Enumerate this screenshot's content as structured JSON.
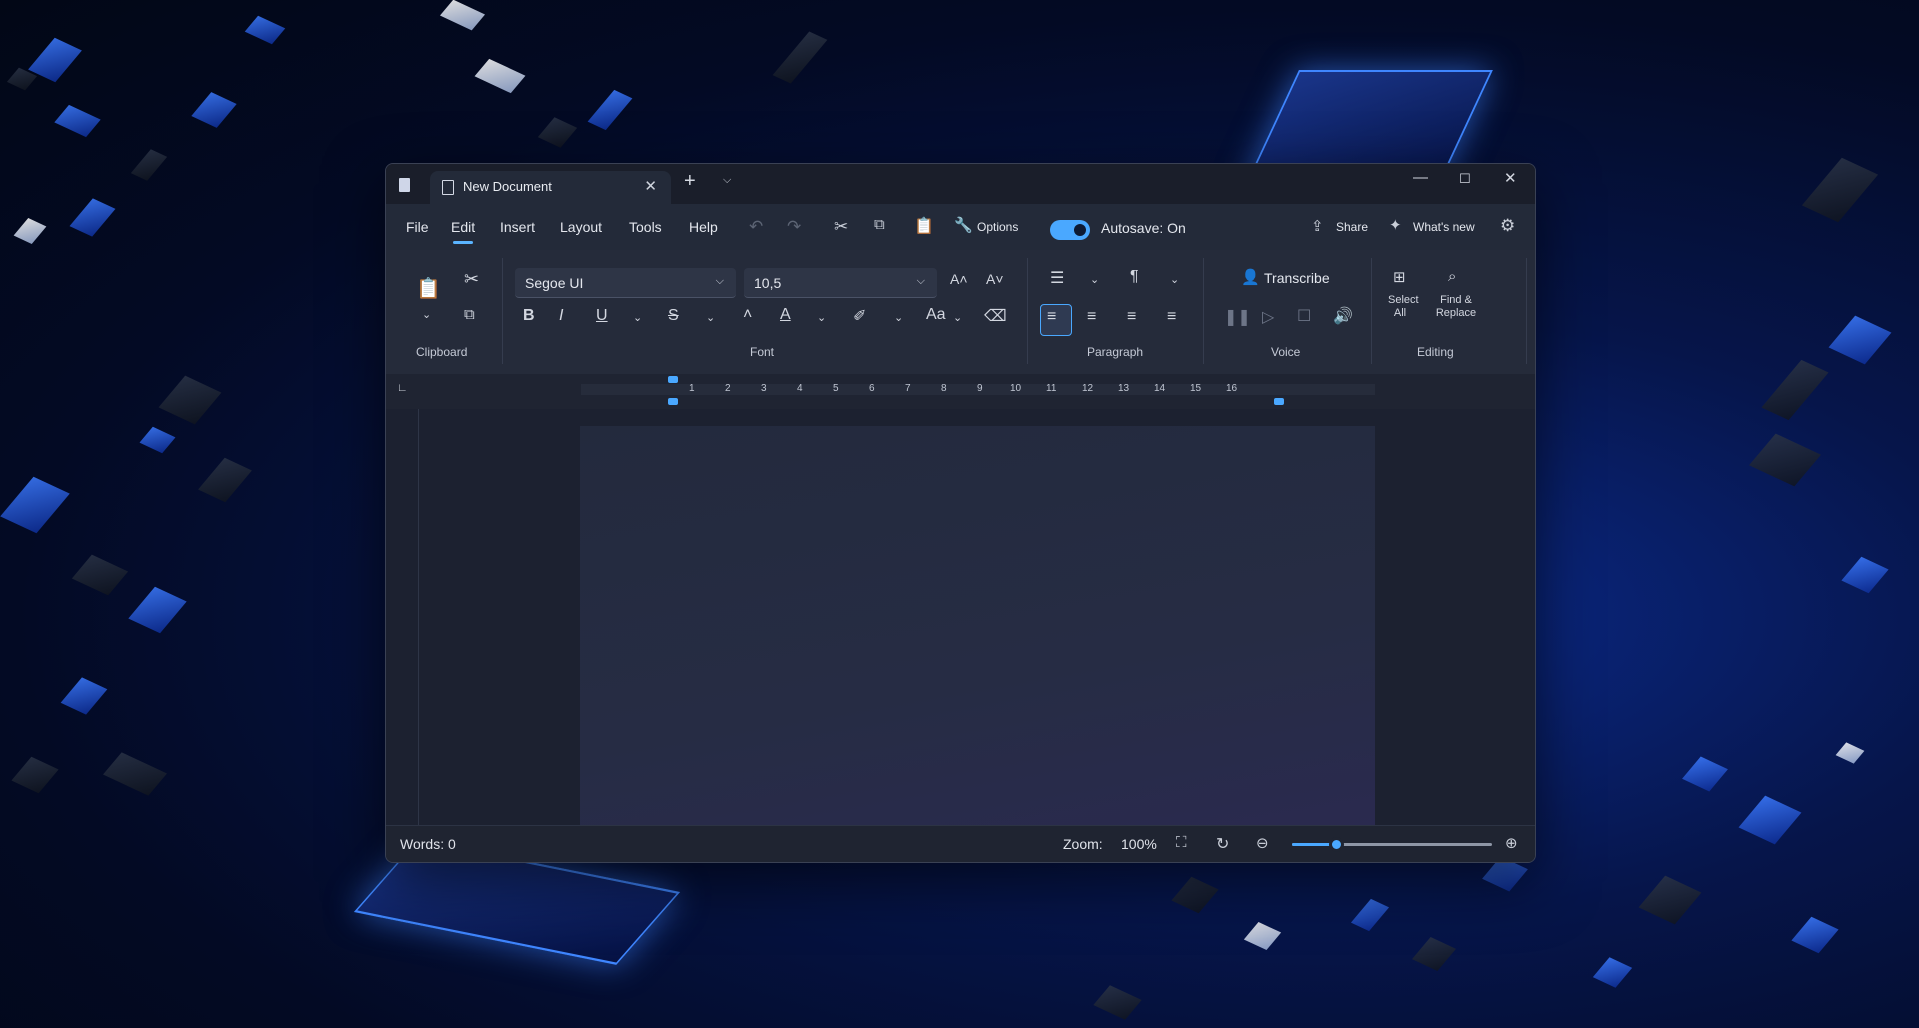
{
  "window": {
    "tab_title": "New Document"
  },
  "menu": {
    "items": [
      "File",
      "Edit",
      "Insert",
      "Layout",
      "Tools",
      "Help"
    ],
    "active": "Edit",
    "options_label": "Options",
    "autosave_label": "Autosave: On",
    "autosave_on": true,
    "share_label": "Share",
    "whats_new_label": "What's new"
  },
  "ribbon": {
    "groups": {
      "clipboard": "Clipboard",
      "font": "Font",
      "paragraph": "Paragraph",
      "voice": "Voice",
      "editing": "Editing"
    },
    "font_family": "Segoe UI",
    "font_size": "10,5",
    "transcribe_label": "Transcribe",
    "select_all_line1": "Select",
    "select_all_line2": "All",
    "find_replace_line1": "Find &",
    "find_replace_line2": "Replace",
    "alignment_selected": "left"
  },
  "ruler": {
    "numbers": [
      "1",
      "2",
      "3",
      "4",
      "5",
      "6",
      "7",
      "8",
      "9",
      "10",
      "11",
      "12",
      "13",
      "14",
      "15",
      "16"
    ]
  },
  "status": {
    "words": "Words: 0",
    "zoom_label": "Zoom:",
    "zoom_value": "100%",
    "zoom_slider_fraction": 0.2
  },
  "colors": {
    "accent": "#4aa8ff",
    "window_bg": "#1d2230"
  }
}
